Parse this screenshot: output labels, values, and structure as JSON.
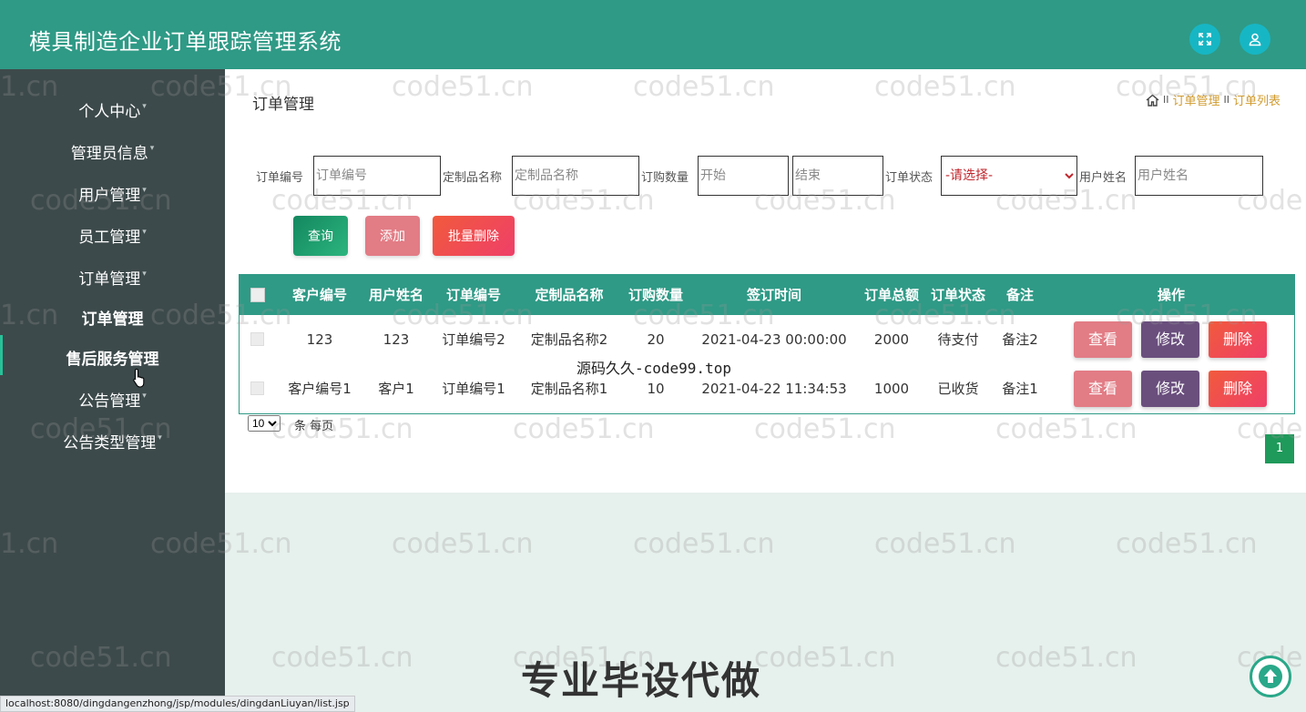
{
  "app": {
    "title": "模具制造企业订单跟踪管理系统"
  },
  "header": {
    "fullscreen_icon": "fullscreen-icon",
    "user_icon": "user-icon"
  },
  "sidebar": {
    "items": [
      {
        "label": "个人中心",
        "caret": "▾"
      },
      {
        "label": "管理员信息",
        "caret": "▾"
      },
      {
        "label": "用户管理",
        "caret": "▾"
      },
      {
        "label": "员工管理",
        "caret": "▾"
      },
      {
        "label": "订单管理",
        "caret": "▾"
      },
      {
        "label": "订单管理"
      },
      {
        "label": "售后服务管理"
      },
      {
        "label": "公告管理",
        "caret": "▾"
      },
      {
        "label": "公告类型管理",
        "caret": "▾"
      }
    ]
  },
  "page": {
    "title": "订单管理",
    "breadcrumb": {
      "sep": "II",
      "items": [
        "订单管理",
        "订单列表"
      ]
    }
  },
  "filters": {
    "order_no": {
      "label": "订单编号",
      "placeholder": "订单编号"
    },
    "product_name": {
      "label": "定制品名称",
      "placeholder": "定制品名称"
    },
    "quantity": {
      "label": "订购数量",
      "start_placeholder": "开始",
      "end_placeholder": "结束"
    },
    "status": {
      "label": "订单状态",
      "selected": "-请选择-"
    },
    "user_name": {
      "label": "用户姓名",
      "placeholder": "用户姓名"
    }
  },
  "actions": {
    "query": "查询",
    "add": "添加",
    "batch_delete": "批量删除"
  },
  "table": {
    "headers": [
      "客户编号",
      "用户姓名",
      "订单编号",
      "定制品名称",
      "订购数量",
      "签订时间",
      "订单总额",
      "订单状态",
      "备注",
      "操作"
    ],
    "rows": [
      {
        "customer_no": "123",
        "user_name": "123",
        "order_no": "订单编号2",
        "product": "定制品名称2",
        "qty": "20",
        "sign_time": "2021-04-23 00:00:00",
        "total": "2000",
        "status": "待支付",
        "remark": "备注2"
      },
      {
        "customer_no": "客户编号1",
        "user_name": "客户1",
        "order_no": "订单编号1",
        "product": "定制品名称1",
        "qty": "10",
        "sign_time": "2021-04-22 11:34:53",
        "total": "1000",
        "status": "已收货",
        "remark": "备注1"
      }
    ],
    "row_actions": {
      "view": "查看",
      "edit": "修改",
      "delete": "删除"
    }
  },
  "pagination": {
    "page_size": "10",
    "page_size_label": "条 每页",
    "current_page": "1"
  },
  "watermark": {
    "text": "code51.cn",
    "partial_left": "1.cn",
    "partial_right": "code"
  },
  "overlay": {
    "caption": "源码久久-code99.top",
    "promo": "专业毕设代做"
  },
  "statusbar": {
    "url": "localhost:8080/dingdangenzhong/jsp/modules/dingdanLiuyan/list.jsp"
  },
  "colors": {
    "header": "#2f9a86",
    "sidebar": "#3d4a4b",
    "breadcrumb": "#d09a2c",
    "delete": "#ef3f69",
    "edit": "#6a4f7d",
    "view": "#e27c85"
  }
}
